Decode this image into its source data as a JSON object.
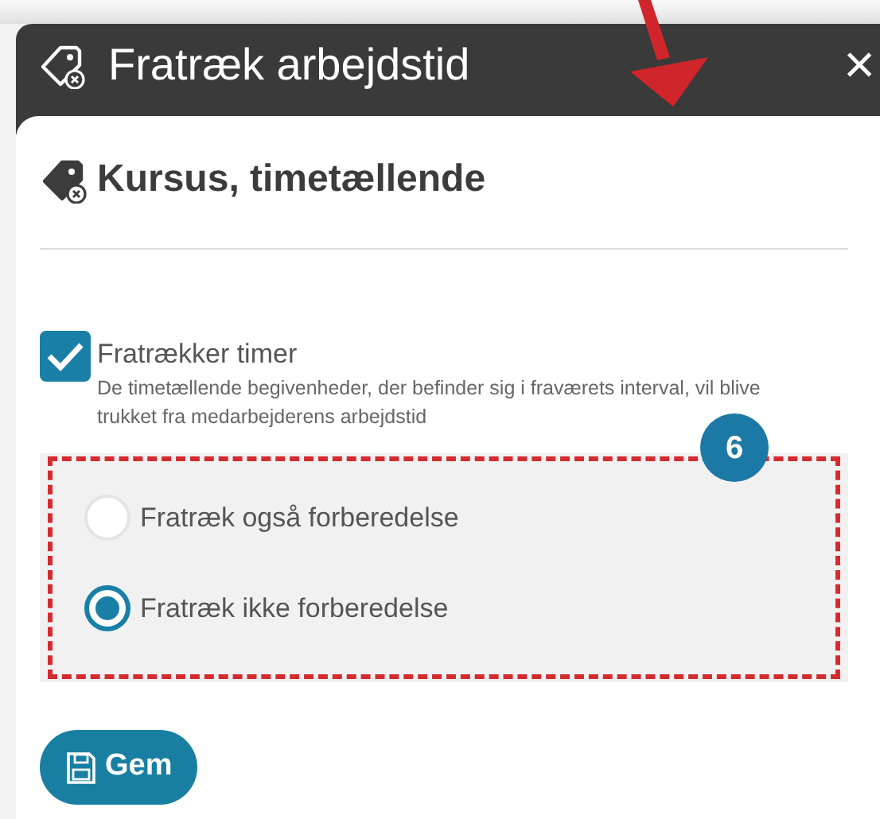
{
  "dialog": {
    "title": "Fratræk arbejdstid",
    "close": "×"
  },
  "heading": "Kursus, timetællende",
  "checkbox": {
    "label": "Fratrækker timer",
    "checked": true,
    "description": "De timetællende begivenheder, der befinder sig i fraværets interval, vil blive trukket fra medarbejderens arbejdstid"
  },
  "badge": "6",
  "options": [
    {
      "label": "Fratræk også forberedelse",
      "selected": false
    },
    {
      "label": "Fratræk ikke forberedelse",
      "selected": true
    }
  ],
  "save_button": "Gem"
}
